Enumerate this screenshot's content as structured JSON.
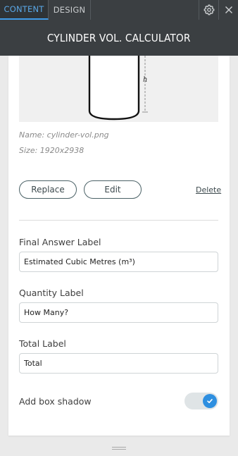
{
  "tabs": [
    {
      "label": "CONTENT",
      "active": true
    },
    {
      "label": "DESIGN",
      "active": false
    }
  ],
  "header": {
    "icons": [
      "gear-icon",
      "close-icon"
    ],
    "title": "CYLINDER VOL. CALCULATOR"
  },
  "image": {
    "name": "Name: cylinder-vol.png",
    "size": "Size: 1920x2938",
    "diagram_label": "h",
    "replace_label": "Replace",
    "edit_label": "Edit",
    "delete_label": "Delete"
  },
  "fields": {
    "final_answer": {
      "label": "Final Answer Label",
      "value": "Estimated Cubic Metres (m³)"
    },
    "quantity": {
      "label": "Quantity Label",
      "value": "How Many?"
    },
    "total": {
      "label": "Total Label",
      "value": "Total"
    }
  },
  "box_shadow": {
    "label": "Add box shadow",
    "enabled": true
  },
  "colors": {
    "accent": "#3f9be8",
    "toggle_on": "#2e8fe0",
    "header_bg": "#3b3f42"
  }
}
